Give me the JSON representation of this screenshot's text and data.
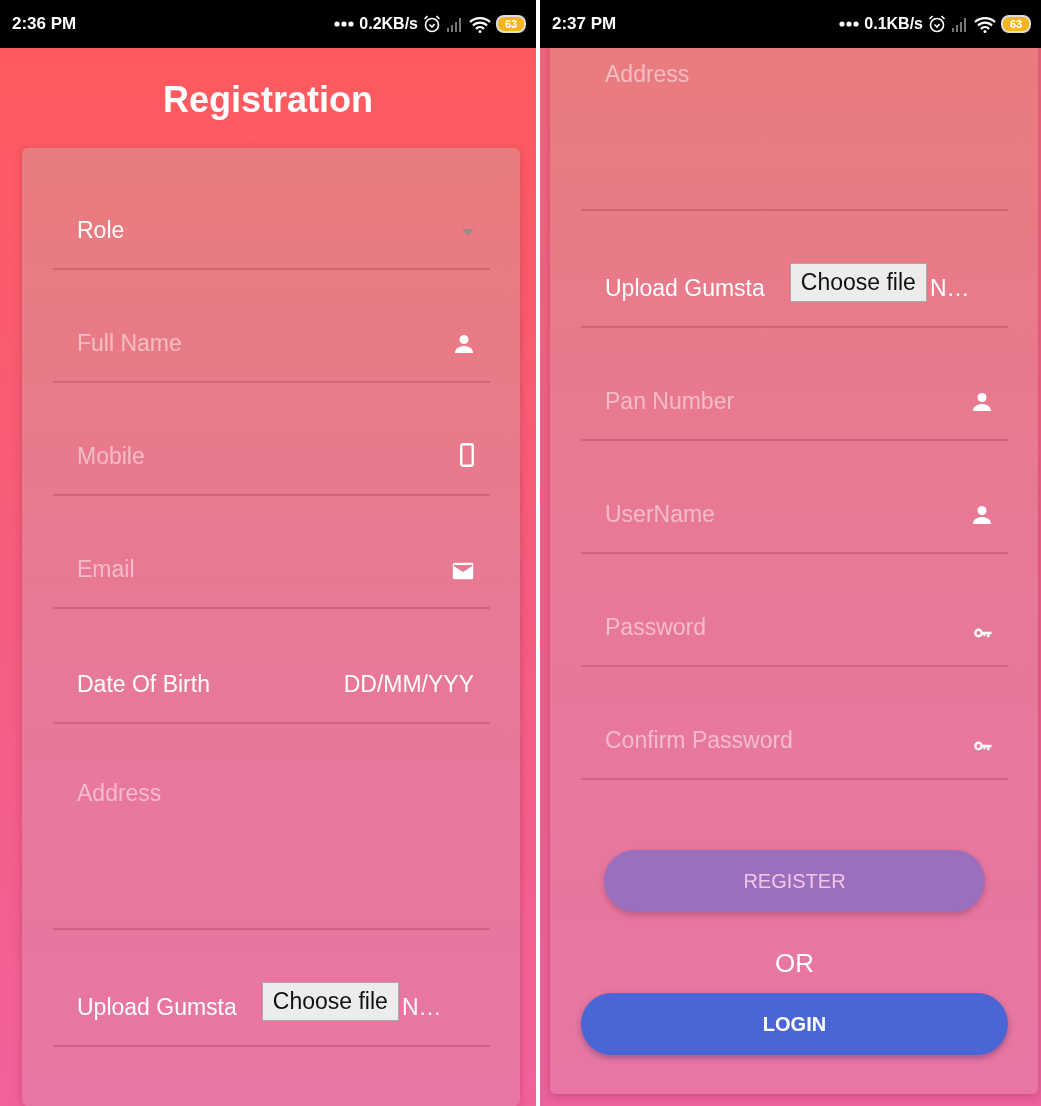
{
  "screens": [
    {
      "status_bar": {
        "time": "2:36 PM",
        "speed": "0.2KB/s",
        "battery": "63"
      },
      "title": "Registration",
      "fields": [
        {
          "kind": "select",
          "label": "Role"
        },
        {
          "kind": "person",
          "placeholder": "Full Name"
        },
        {
          "kind": "phone",
          "placeholder": "Mobile"
        },
        {
          "kind": "email",
          "placeholder": "Email"
        },
        {
          "kind": "date",
          "label": "Date Of Birth",
          "value": "DD/MM/YYY"
        },
        {
          "kind": "textarea",
          "placeholder": "Address"
        },
        {
          "kind": "file",
          "label": "Upload Gumsta",
          "button": "Choose file",
          "file_name": "N…"
        }
      ]
    },
    {
      "status_bar": {
        "time": "2:37 PM",
        "speed": "0.1KB/s",
        "battery": "63"
      },
      "fields": [
        {
          "kind": "textarea",
          "placeholder": "Address"
        },
        {
          "kind": "file",
          "label": "Upload Gumsta",
          "button": "Choose file",
          "file_name": "N…"
        },
        {
          "kind": "person",
          "placeholder": "Pan Number"
        },
        {
          "kind": "person",
          "placeholder": "UserName"
        },
        {
          "kind": "password",
          "placeholder": "Password"
        },
        {
          "kind": "password",
          "placeholder": "Confirm Password"
        }
      ],
      "register_button": "REGISTER",
      "separator": "OR",
      "login_button": "LOGIN"
    }
  ]
}
